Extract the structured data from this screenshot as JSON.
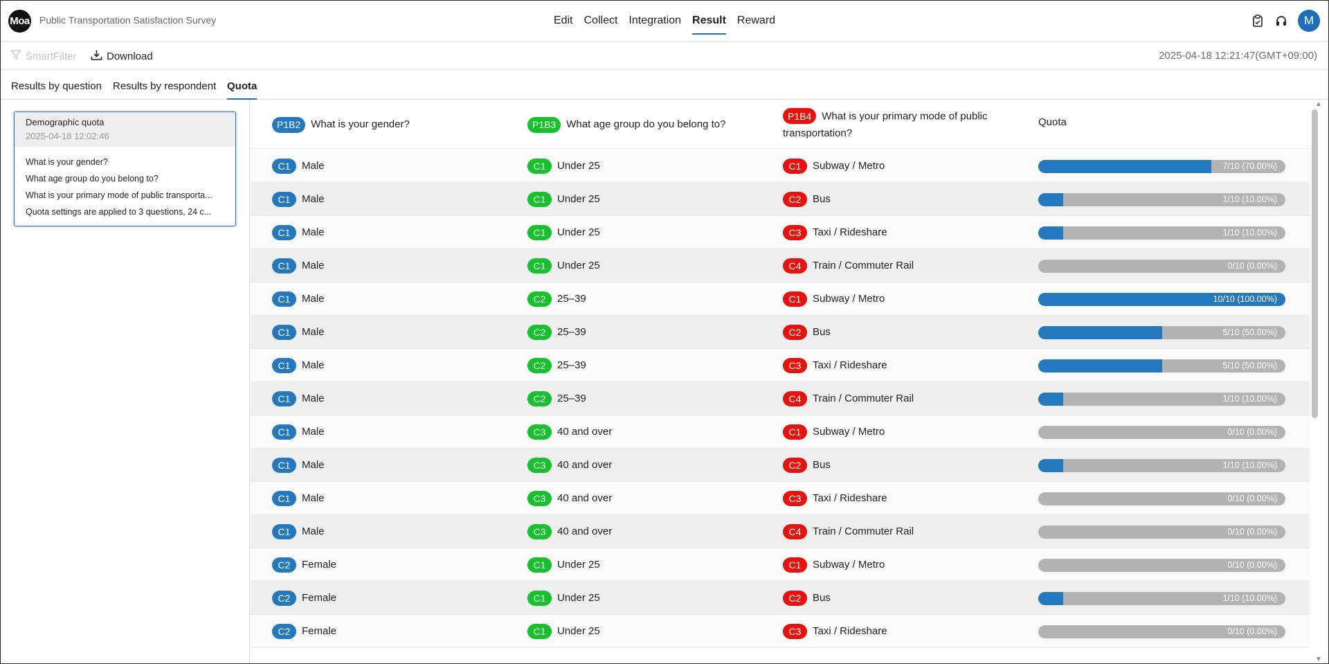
{
  "header": {
    "logo": "Moa",
    "title": "Public Transportation Satisfaction Survey",
    "nav": [
      "Edit",
      "Collect",
      "Integration",
      "Result",
      "Reward"
    ],
    "active_nav": "Result",
    "avatar_initial": "M",
    "icons": [
      "clipboard-icon",
      "headset-icon"
    ]
  },
  "toolbar": {
    "smartfilter_label": "SmartFilter",
    "download_label": "Download",
    "timestamp": "2025-04-18 12:21:47(GMT+09:00)"
  },
  "tabs": [
    "Results by question",
    "Results by respondent",
    "Quota"
  ],
  "active_tab": "Quota",
  "sidebar": {
    "card": {
      "name": "Demographic quota",
      "date": "2025-04-18 12:02:46",
      "lines": [
        "What is your gender?",
        "What age group do you belong to?",
        "What is your primary mode of public transporta...",
        "Quota settings are applied to 3 questions, 24 c..."
      ]
    }
  },
  "colors": {
    "blue": "#2378be",
    "green": "#17c12b",
    "red": "#e8120c",
    "bar_track": "#b3b3b3"
  },
  "table": {
    "headers": [
      {
        "tag": "P1B2",
        "text": "What is your gender?",
        "color": "blue"
      },
      {
        "tag": "P1B3",
        "text": "What age group do you belong to?",
        "color": "green"
      },
      {
        "tag": "P1B4",
        "text": "What is your primary mode of public transportation?",
        "color": "red"
      }
    ],
    "quota_header": "Quota",
    "rows": [
      {
        "g": [
          "C1",
          "Male"
        ],
        "a": [
          "C1",
          "Under 25"
        ],
        "m": [
          "C1",
          "Subway / Metro"
        ],
        "progress": 0.7,
        "label": "7/10 (70.00%)"
      },
      {
        "g": [
          "C1",
          "Male"
        ],
        "a": [
          "C1",
          "Under 25"
        ],
        "m": [
          "C2",
          "Bus"
        ],
        "progress": 0.1,
        "label": "1/10 (10.00%)"
      },
      {
        "g": [
          "C1",
          "Male"
        ],
        "a": [
          "C1",
          "Under 25"
        ],
        "m": [
          "C3",
          "Taxi / Rideshare"
        ],
        "progress": 0.1,
        "label": "1/10 (10.00%)"
      },
      {
        "g": [
          "C1",
          "Male"
        ],
        "a": [
          "C1",
          "Under 25"
        ],
        "m": [
          "C4",
          "Train / Commuter Rail"
        ],
        "progress": 0,
        "label": "0/10 (0.00%)"
      },
      {
        "g": [
          "C1",
          "Male"
        ],
        "a": [
          "C2",
          "25–39"
        ],
        "m": [
          "C1",
          "Subway / Metro"
        ],
        "progress": 1.0,
        "label": "10/10 (100.00%)"
      },
      {
        "g": [
          "C1",
          "Male"
        ],
        "a": [
          "C2",
          "25–39"
        ],
        "m": [
          "C2",
          "Bus"
        ],
        "progress": 0.5,
        "label": "5/10 (50.00%)"
      },
      {
        "g": [
          "C1",
          "Male"
        ],
        "a": [
          "C2",
          "25–39"
        ],
        "m": [
          "C3",
          "Taxi / Rideshare"
        ],
        "progress": 0.5,
        "label": "5/10 (50.00%)"
      },
      {
        "g": [
          "C1",
          "Male"
        ],
        "a": [
          "C2",
          "25–39"
        ],
        "m": [
          "C4",
          "Train / Commuter Rail"
        ],
        "progress": 0.1,
        "label": "1/10 (10.00%)"
      },
      {
        "g": [
          "C1",
          "Male"
        ],
        "a": [
          "C3",
          "40 and over"
        ],
        "m": [
          "C1",
          "Subway / Metro"
        ],
        "progress": 0,
        "label": "0/10 (0.00%)"
      },
      {
        "g": [
          "C1",
          "Male"
        ],
        "a": [
          "C3",
          "40 and over"
        ],
        "m": [
          "C2",
          "Bus"
        ],
        "progress": 0.1,
        "label": "1/10 (10.00%)"
      },
      {
        "g": [
          "C1",
          "Male"
        ],
        "a": [
          "C3",
          "40 and over"
        ],
        "m": [
          "C3",
          "Taxi / Rideshare"
        ],
        "progress": 0,
        "label": "0/10 (0.00%)"
      },
      {
        "g": [
          "C1",
          "Male"
        ],
        "a": [
          "C3",
          "40 and over"
        ],
        "m": [
          "C4",
          "Train / Commuter Rail"
        ],
        "progress": 0,
        "label": "0/10 (0.00%)"
      },
      {
        "g": [
          "C2",
          "Female"
        ],
        "a": [
          "C1",
          "Under 25"
        ],
        "m": [
          "C1",
          "Subway / Metro"
        ],
        "progress": 0,
        "label": "0/10 (0.00%)"
      },
      {
        "g": [
          "C2",
          "Female"
        ],
        "a": [
          "C1",
          "Under 25"
        ],
        "m": [
          "C2",
          "Bus"
        ],
        "progress": 0.1,
        "label": "1/10 (10.00%)"
      },
      {
        "g": [
          "C2",
          "Female"
        ],
        "a": [
          "C1",
          "Under 25"
        ],
        "m": [
          "C3",
          "Taxi / Rideshare"
        ],
        "progress": 0,
        "label": "0/10 (0.00%)"
      }
    ]
  }
}
